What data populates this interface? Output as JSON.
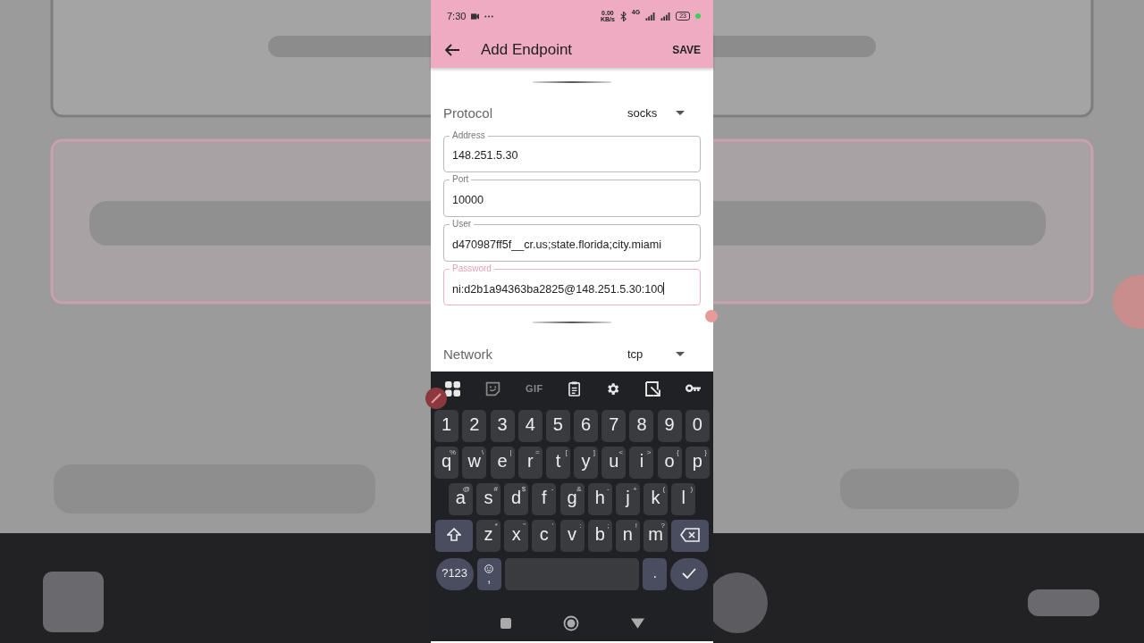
{
  "status_bar": {
    "time": "7:30",
    "speed": "0.00",
    "speed_unit": "KB/s",
    "network": "4G",
    "battery": "23"
  },
  "app_bar": {
    "title": "Add Endpoint",
    "action": "SAVE"
  },
  "form": [
    {
      "kind": "handle"
    },
    {
      "kind": "select",
      "label": "Protocol",
      "value": "socks"
    },
    {
      "kind": "field",
      "label": "Address",
      "value": "148.251.5.30",
      "focused": false
    },
    {
      "kind": "field",
      "label": "Port",
      "value": "10000",
      "focused": false
    },
    {
      "kind": "field",
      "label": "User",
      "value": "d470987ff5f__cr.us;state.florida;city.miami",
      "focused": false
    },
    {
      "kind": "field",
      "label": "Password",
      "value": "ni:d2b1a94363ba2825@148.251.5.30:100",
      "focused": true
    },
    {
      "kind": "handle"
    },
    {
      "kind": "select",
      "label": "Network",
      "value": "tcp"
    }
  ],
  "keyboard": {
    "toolbar": [
      {
        "kind": "grid"
      },
      {
        "kind": "sticker"
      },
      {
        "kind": "text",
        "label": "GIF"
      },
      {
        "kind": "clipboard"
      },
      {
        "kind": "gear"
      },
      {
        "kind": "crop"
      },
      {
        "kind": "key"
      }
    ],
    "rows": [
      [
        {
          "label": "1"
        },
        {
          "label": "2"
        },
        {
          "label": "3"
        },
        {
          "label": "4"
        },
        {
          "label": "5"
        },
        {
          "label": "6"
        },
        {
          "label": "7"
        },
        {
          "label": "8"
        },
        {
          "label": "9"
        },
        {
          "label": "0"
        }
      ],
      [
        {
          "label": "q",
          "hint": "%"
        },
        {
          "label": "w",
          "hint": "\\"
        },
        {
          "label": "e",
          "hint": "|"
        },
        {
          "label": "r",
          "hint": "="
        },
        {
          "label": "t",
          "hint": "["
        },
        {
          "label": "y",
          "hint": "]"
        },
        {
          "label": "u",
          "hint": "<"
        },
        {
          "label": "i",
          "hint": ">"
        },
        {
          "label": "o",
          "hint": "{"
        },
        {
          "label": "p",
          "hint": "}"
        }
      ],
      [
        {
          "label": "a",
          "hint": "@"
        },
        {
          "label": "s",
          "hint": "#"
        },
        {
          "label": "d",
          "hint": "$"
        },
        {
          "label": "f",
          "hint": "-"
        },
        {
          "label": "g",
          "hint": "&"
        },
        {
          "label": "h",
          "hint": "-"
        },
        {
          "label": "j",
          "hint": "+"
        },
        {
          "label": "k",
          "hint": "("
        },
        {
          "label": "l",
          "hint": ")"
        }
      ],
      [
        {
          "kind": "shift"
        },
        {
          "label": "z",
          "hint": "*"
        },
        {
          "label": "x",
          "hint": "\""
        },
        {
          "label": "c",
          "hint": "'"
        },
        {
          "label": "v",
          "hint": ":"
        },
        {
          "label": "b",
          "hint": ";"
        },
        {
          "label": "n",
          "hint": "!"
        },
        {
          "label": "m",
          "hint": "?"
        },
        {
          "kind": "backspace"
        }
      ],
      [
        {
          "kind": "symbols",
          "label": "?123"
        },
        {
          "kind": "emoji",
          "hint": ","
        },
        {
          "kind": "space"
        },
        {
          "kind": "period",
          "label": "."
        },
        {
          "kind": "enter"
        }
      ]
    ]
  }
}
